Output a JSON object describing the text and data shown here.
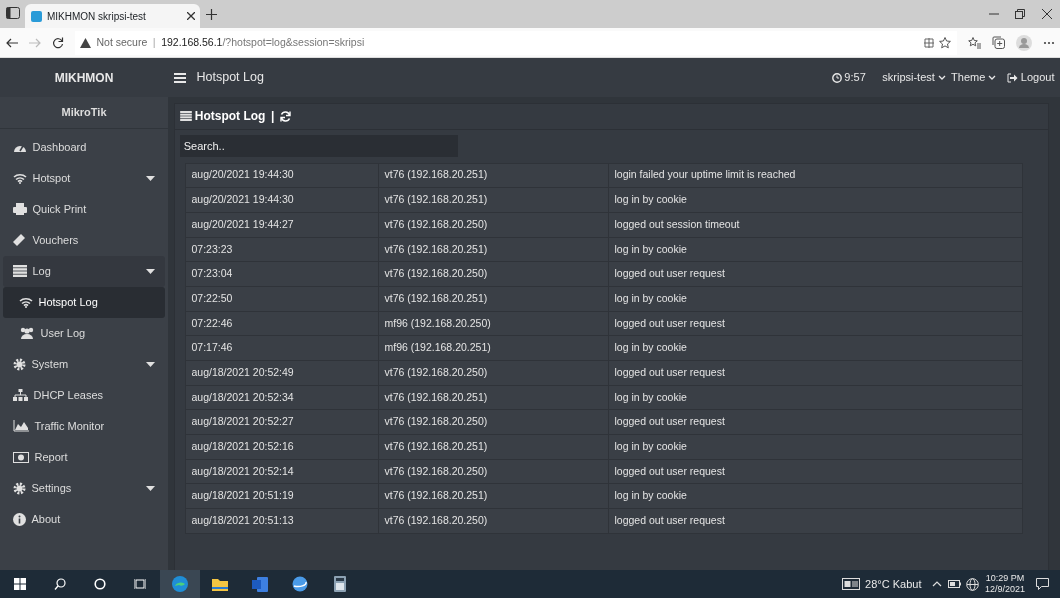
{
  "browser": {
    "tab_title": "MIKHMON skripsi-test",
    "security": "Not secure",
    "url_separator": "|",
    "url_host": "192.168.56.1",
    "url_path": "/?hotspot=log&session=skripsi"
  },
  "navbar": {
    "brand": "MIKHMON",
    "page_title": "Hotspot Log",
    "clock": "9:57",
    "user": "skripsi-test",
    "theme": "Theme",
    "logout": "Logout"
  },
  "sidebar": {
    "header": "MikroTik",
    "items": [
      {
        "label": "Dashboard",
        "kind": "link",
        "selected": false
      },
      {
        "label": "Hotspot",
        "kind": "menu",
        "selected": false
      },
      {
        "label": "Quick Print",
        "kind": "link",
        "selected": false
      },
      {
        "label": "Vouchers",
        "kind": "link",
        "selected": false
      },
      {
        "label": "Log",
        "kind": "menu",
        "selected": false,
        "expanded": true,
        "children": [
          {
            "label": "Hotspot Log",
            "selected": true
          },
          {
            "label": "User Log",
            "selected": false
          }
        ]
      },
      {
        "label": "System",
        "kind": "menu",
        "selected": false
      },
      {
        "label": "DHCP Leases",
        "kind": "link",
        "selected": false
      },
      {
        "label": "Traffic Monitor",
        "kind": "link",
        "selected": false
      },
      {
        "label": "Report",
        "kind": "link",
        "selected": false
      },
      {
        "label": "Settings",
        "kind": "menu",
        "selected": false
      },
      {
        "label": "About",
        "kind": "link",
        "selected": false
      }
    ]
  },
  "card": {
    "title": "Hotspot Log",
    "separator": "|",
    "search": {
      "placeholder": "Search.."
    },
    "rows": [
      [
        "aug/20/2021 19:44:30",
        "vt76 (192.168.20.251)",
        "login failed your uptime limit is reached"
      ],
      [
        "aug/20/2021 19:44:30",
        "vt76 (192.168.20.251)",
        "log in by cookie"
      ],
      [
        "aug/20/2021 19:44:27",
        "vt76 (192.168.20.250)",
        "logged out session timeout"
      ],
      [
        "07:23:23",
        "vt76 (192.168.20.251)",
        "log in by cookie"
      ],
      [
        "07:23:04",
        "vt76 (192.168.20.250)",
        "logged out user request"
      ],
      [
        "07:22:50",
        "vt76 (192.168.20.251)",
        "log in by cookie"
      ],
      [
        "07:22:46",
        "mf96 (192.168.20.250)",
        "logged out user request"
      ],
      [
        "07:17:46",
        "mf96 (192.168.20.251)",
        "log in by cookie"
      ],
      [
        "aug/18/2021 20:52:49",
        "vt76 (192.168.20.250)",
        "logged out user request"
      ],
      [
        "aug/18/2021 20:52:34",
        "vt76 (192.168.20.251)",
        "log in by cookie"
      ],
      [
        "aug/18/2021 20:52:27",
        "vt76 (192.168.20.250)",
        "logged out user request"
      ],
      [
        "aug/18/2021 20:52:16",
        "vt76 (192.168.20.251)",
        "log in by cookie"
      ],
      [
        "aug/18/2021 20:52:14",
        "vt76 (192.168.20.250)",
        "logged out user request"
      ],
      [
        "aug/18/2021 20:51:19",
        "vt76 (192.168.20.251)",
        "log in by cookie"
      ],
      [
        "aug/18/2021 20:51:13",
        "vt76 (192.168.20.250)",
        "logged out user request"
      ]
    ]
  },
  "taskbar": {
    "weather": "28°C Kabut",
    "time": "10:29 PM",
    "date": "12/9/2021"
  }
}
